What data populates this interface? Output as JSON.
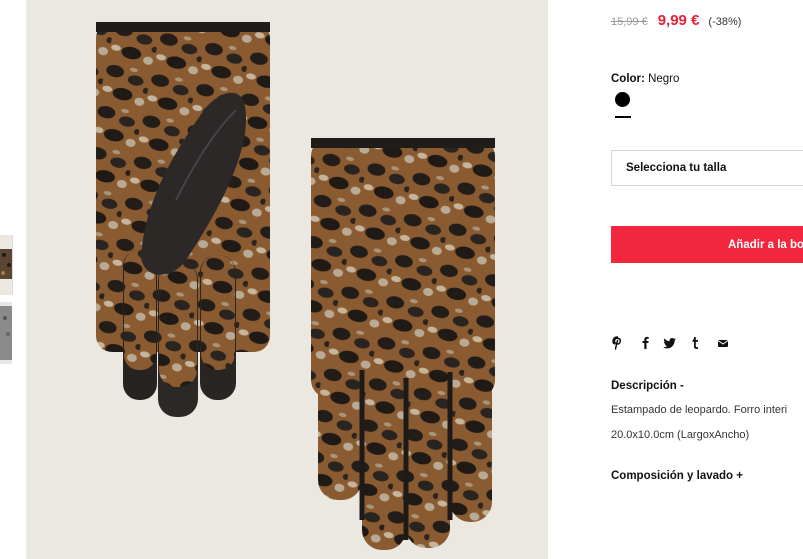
{
  "product": {
    "old_price": "15,99 €",
    "new_price": "9,99 €",
    "discount": "(-38%)",
    "image_alt": "Guantes estampado leopardo"
  },
  "color": {
    "label": "Color:",
    "value": "Negro",
    "swatch_color": "#000000"
  },
  "size": {
    "placeholder": "Selecciona tu talla"
  },
  "cart": {
    "add_label": "Añadir a la bo"
  },
  "share": {
    "icons": [
      "pinterest-icon",
      "facebook-icon",
      "twitter-icon",
      "tumblr-icon",
      "email-icon"
    ],
    "glyphs": [
      "℗",
      "f",
      "🐦",
      "t",
      "✉"
    ]
  },
  "description": {
    "title": "Descripción -",
    "text": "Estampado de leopardo. Forro interi",
    "dimensions": "20.0x10.0cm (LargoxAncho)"
  },
  "composition": {
    "title": "Composición y lavado +"
  },
  "colors": {
    "accent": "#f2263d",
    "price_red": "#e6213a"
  }
}
